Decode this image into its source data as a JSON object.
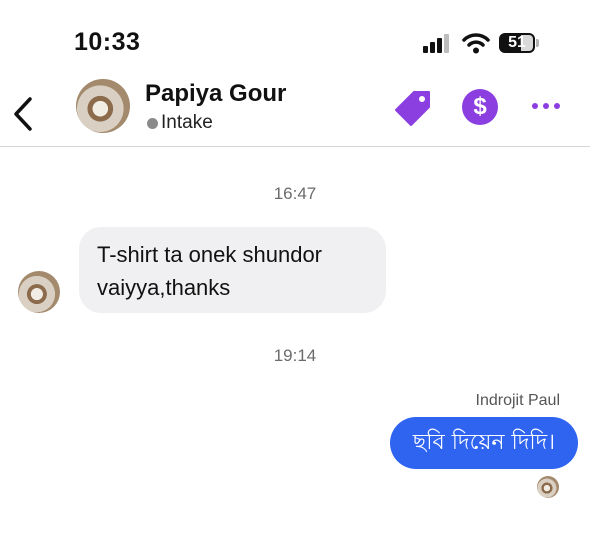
{
  "status_bar": {
    "time": "10:33",
    "battery_level": "51"
  },
  "header": {
    "contact_name": "Papiya Gour",
    "status": "Intake",
    "icons": {
      "back": "chevron-left-icon",
      "tag": "tag-icon",
      "payment": "dollar-icon",
      "more": "more-icon"
    },
    "accent_color": "#8b3fe0"
  },
  "messages": {
    "timestamps": [
      "16:47",
      "19:14"
    ],
    "incoming_text": "T-shirt ta onek shundor vaiyya,thanks",
    "outgoing_sender": "Indrojit Paul",
    "outgoing_text": "ছবি দিয়েন দিদি।",
    "outgoing_color": "#2f64f0"
  }
}
